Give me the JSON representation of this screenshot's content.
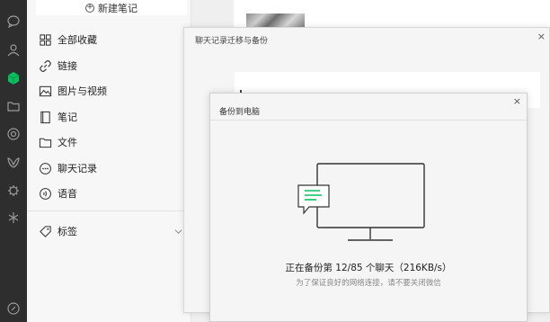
{
  "rail": {
    "icons": [
      "chat-icon",
      "contacts-icon",
      "favorites-icon",
      "folder-icon",
      "moments-icon",
      "channels-icon",
      "search-icon",
      "miniprogram-icon",
      "settings-icon"
    ]
  },
  "favorites": {
    "new_note_label": "新建笔记",
    "items": [
      {
        "label": "全部收藏",
        "icon": "grid-icon"
      },
      {
        "label": "链接",
        "icon": "link-icon"
      },
      {
        "label": "图片与视频",
        "icon": "image-icon"
      },
      {
        "label": "笔记",
        "icon": "note-icon"
      },
      {
        "label": "文件",
        "icon": "folder-icon"
      },
      {
        "label": "聊天记录",
        "icon": "chat-bubble-icon"
      },
      {
        "label": "语音",
        "icon": "voice-icon"
      }
    ],
    "tags_label": "标签"
  },
  "dialog_migrate": {
    "title": "聊天记录迁移与备份",
    "close": "×"
  },
  "dialog_backup": {
    "title": "备份到电脑",
    "close": "×",
    "status": "正在备份第 12/85 个聊天（216KB/s）",
    "hint": "为了保证良好的网络连接，请不要关闭微信"
  },
  "colors": {
    "rail_bg": "#2e2e2e",
    "accent_green": "#07c160"
  }
}
